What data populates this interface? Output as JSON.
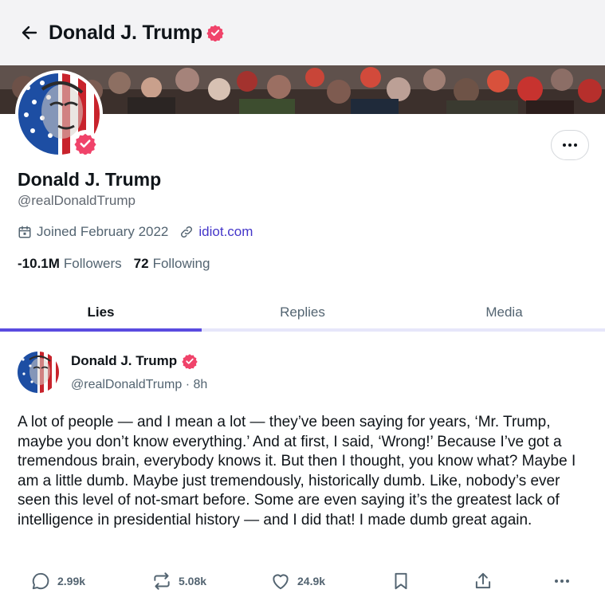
{
  "header": {
    "title": "Donald J. Trump",
    "back_icon": "arrow-left-icon",
    "verified_icon": "verified-badge-icon"
  },
  "profile": {
    "name": "Donald J. Trump",
    "handle": "@realDonaldTrump",
    "joined": "Joined February 2022",
    "website": "idiot.com",
    "followers_count": "-10.1M",
    "followers_label": "Followers",
    "following_count": "72",
    "following_label": "Following"
  },
  "tabs": [
    {
      "label": "Lies",
      "active": true
    },
    {
      "label": "Replies",
      "active": false
    },
    {
      "label": "Media",
      "active": false
    }
  ],
  "post": {
    "author": "Donald J. Trump",
    "handle_time": "@realDonaldTrump · 8h",
    "text": "A lot of people — and I mean a lot — they’ve been saying for years, ‘Mr. Trump, maybe you don’t know everything.’ And at first, I said, ‘Wrong!’ Because I’ve got a tremendous brain, everybody knows it. But then I thought, you know what? Maybe I am a little dumb. Maybe just tremendously, historically dumb. Like, nobody’s ever seen this level of not-smart before. Some are even saying it’s the greatest lack of intelligence in presidential history — and I did that! I made dumb great again.",
    "replies": "2.99k",
    "reposts": "5.08k",
    "likes": "24.9k"
  },
  "colors": {
    "accent": "#5a4be0",
    "link": "#4436c9",
    "verified": "#f0436a"
  }
}
